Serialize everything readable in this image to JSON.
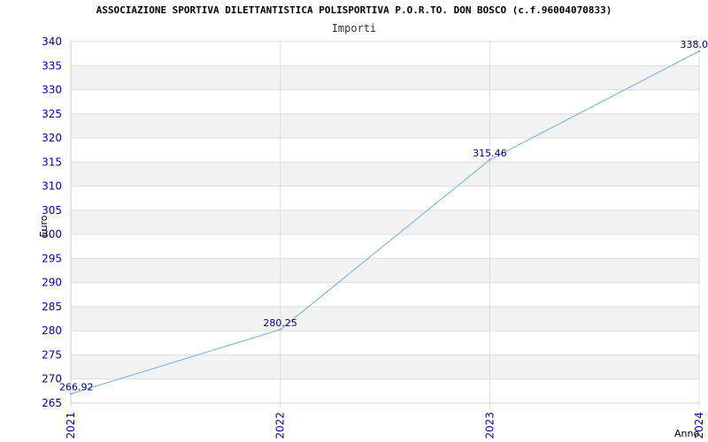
{
  "chart_data": {
    "type": "line",
    "title": "ASSOCIAZIONE SPORTIVA DILETTANTISTICA POLISPORTIVA P.O.R.TO. DON BOSCO (c.f.96004070833)",
    "subtitle": "Importi",
    "xlabel": "Anno",
    "ylabel": "Euro",
    "categories": [
      "2021",
      "2022",
      "2023",
      "2024"
    ],
    "values": [
      266.92,
      280.25,
      315.46,
      338.0
    ],
    "value_labels": [
      "266.92",
      "280.25",
      "315.46",
      "338.0"
    ],
    "ylim": [
      265,
      340
    ],
    "yticks": [
      265,
      270,
      275,
      280,
      285,
      290,
      295,
      300,
      305,
      310,
      315,
      320,
      325,
      330,
      335,
      340
    ],
    "grid": true,
    "line_color": "#6aaee8",
    "tick_color": "#0000aa",
    "band_color": "#f2f2f2"
  }
}
